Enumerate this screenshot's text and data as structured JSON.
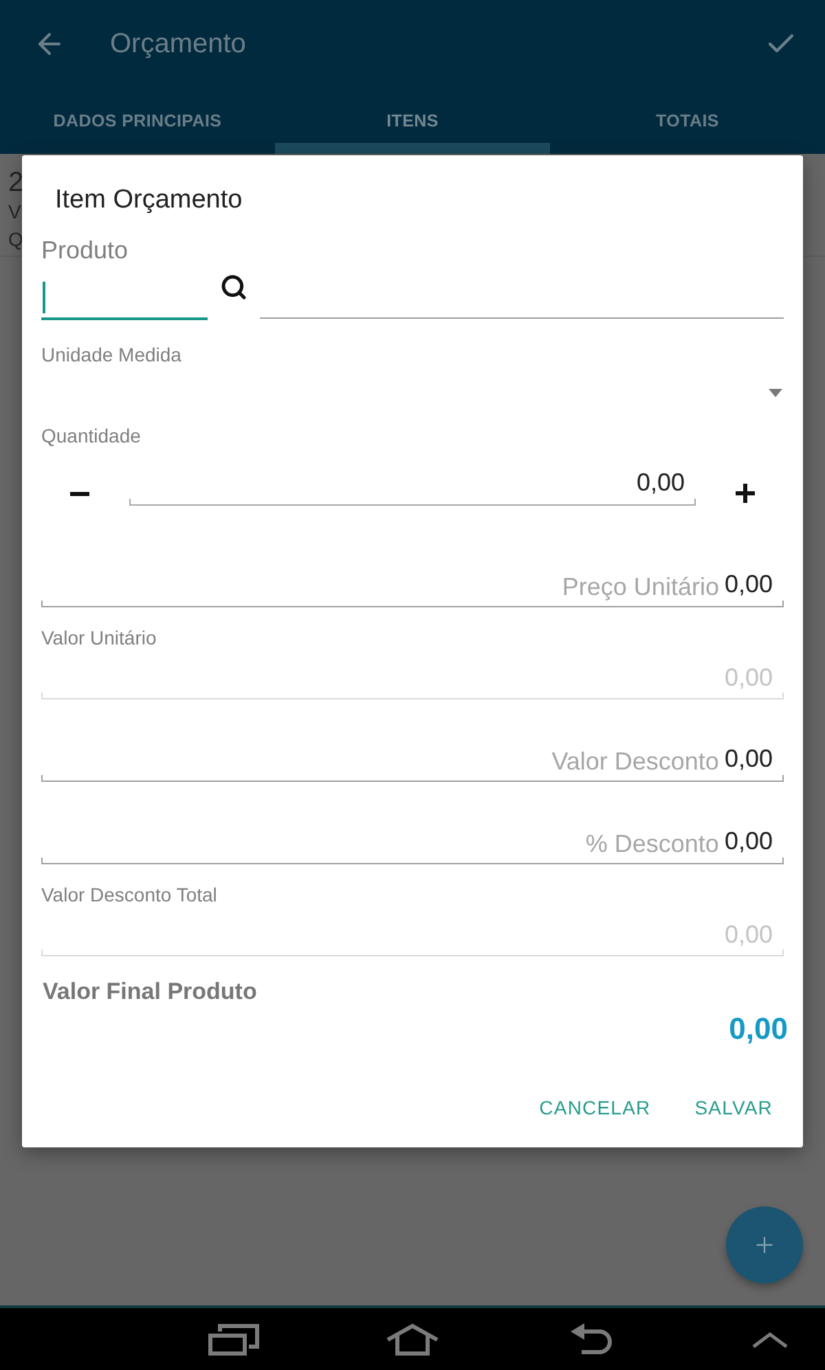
{
  "app_bar": {
    "title": "Orçamento"
  },
  "tabs": [
    {
      "label": "DADOS PRINCIPAIS",
      "selected": false
    },
    {
      "label": "ITENS",
      "selected": true
    },
    {
      "label": "TOTAIS",
      "selected": false
    }
  ],
  "background_item": {
    "line_1": "2",
    "line_2": "V",
    "line_3": "Q"
  },
  "dialog": {
    "title": "Item Orçamento",
    "product": {
      "label": "Produto",
      "code_field": {
        "focused": true
      },
      "description_field": {
        "focused": false
      }
    },
    "unit": {
      "label": "Unidade Medida"
    },
    "quantity": {
      "label": "Quantidade",
      "value": "0,00"
    },
    "fields": [
      {
        "kind": "hint",
        "placeholder": "Preço Unitário",
        "value": "0,00",
        "disabled": false
      },
      {
        "kind": "labeled",
        "label": "Valor Unitário",
        "value": "0,00",
        "disabled": true
      },
      {
        "kind": "hint",
        "placeholder": "Valor Desconto",
        "value": "0,00",
        "disabled": false
      },
      {
        "kind": "hint",
        "placeholder": "% Desconto",
        "value": "0,00",
        "disabled": false
      },
      {
        "kind": "labeled",
        "label": "Valor Desconto Total",
        "value": "0,00",
        "disabled": true
      }
    ],
    "total": {
      "label": "Valor Final Produto",
      "value": "0,00"
    },
    "buttons": [
      {
        "label": "CANCELAR"
      },
      {
        "label": "SALVAR"
      }
    ]
  }
}
